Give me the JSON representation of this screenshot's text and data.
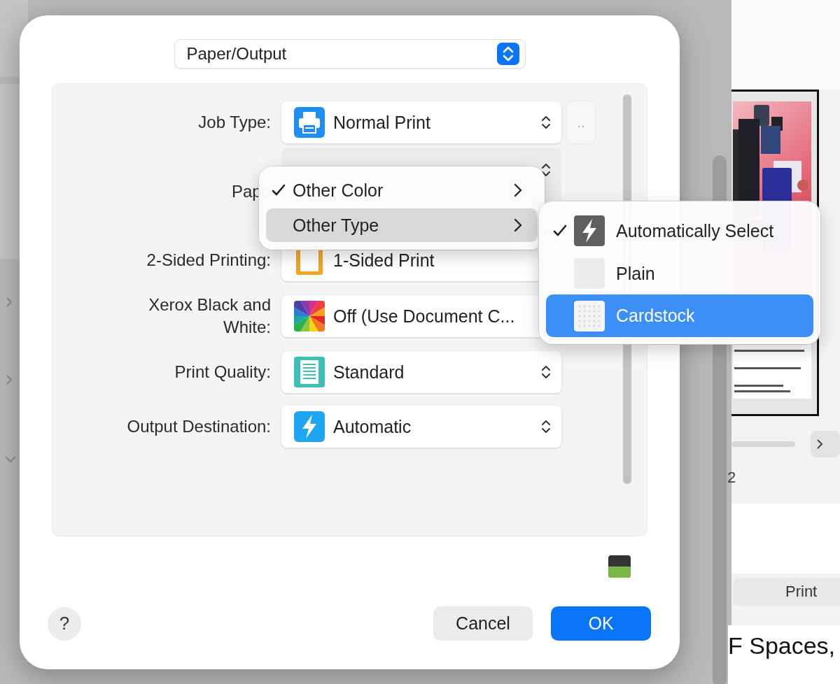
{
  "dialog": {
    "section_popup": "Paper/Output",
    "rows": [
      {
        "label": "Job Type:",
        "value": "Normal Print",
        "extra_button": ".."
      },
      {
        "label": "Pape"
      },
      {
        "label": "2-Sided Printing:",
        "value": "1-Sided Print"
      },
      {
        "label": "Xerox Black and White:",
        "value": "Off (Use Document C..."
      },
      {
        "label": "Print Quality:",
        "value": "Standard"
      },
      {
        "label": "Output Destination:",
        "value": "Automatic"
      }
    ],
    "menu": [
      {
        "label": "Other Color",
        "checked": true,
        "selected": false
      },
      {
        "label": "Other Type",
        "checked": false,
        "selected": true
      }
    ],
    "submenu": [
      {
        "label": "Automatically Select",
        "checked": true,
        "selected": false
      },
      {
        "label": "Plain",
        "checked": false,
        "selected": false
      },
      {
        "label": "Cardstock",
        "checked": false,
        "selected": true
      }
    ],
    "help_button": "?",
    "buttons": [
      {
        "label": "Cancel",
        "kind": "secondary"
      },
      {
        "label": "OK",
        "kind": "primary"
      }
    ]
  },
  "preview": {
    "page_number": "2",
    "print_button": "Print",
    "caption": "F Spaces,"
  }
}
